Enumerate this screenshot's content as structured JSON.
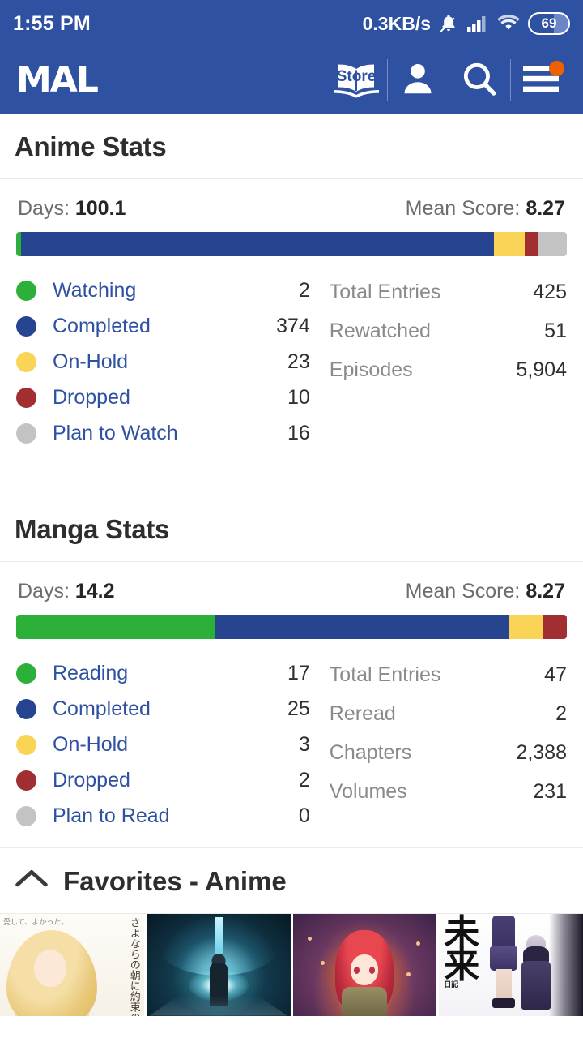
{
  "status_bar": {
    "time": "1:55 PM",
    "network_speed": "0.3KB/s",
    "battery_level": "69",
    "icons": [
      "bell-muted-icon",
      "signal-icon",
      "wifi-icon",
      "battery-icon"
    ]
  },
  "app_bar": {
    "logo": "MAL",
    "store_label": "Store",
    "icons": [
      "store-icon",
      "profile-icon",
      "search-icon",
      "menu-icon"
    ],
    "has_notification": true,
    "background": "#2e51a2",
    "notification_color": "#ef6100"
  },
  "anime_stats": {
    "title": "Anime Stats",
    "days_label": "Days:",
    "days_value": "100.1",
    "mean_score_label": "Mean Score:",
    "mean_score_value": "8.27",
    "legend": [
      {
        "label": "Watching",
        "value": "2",
        "color": "#2db039"
      },
      {
        "label": "Completed",
        "value": "374",
        "color": "#26448f"
      },
      {
        "label": "On-Hold",
        "value": "23",
        "color": "#f9d457"
      },
      {
        "label": "Dropped",
        "value": "10",
        "color": "#a12f31"
      },
      {
        "label": "Plan to Watch",
        "value": "16",
        "color": "#c3c3c3"
      }
    ],
    "side_stats": [
      {
        "label": "Total Entries",
        "value": "425"
      },
      {
        "label": "Rewatched",
        "value": "51"
      },
      {
        "label": "Episodes",
        "value": "5,904"
      }
    ]
  },
  "manga_stats": {
    "title": "Manga Stats",
    "days_label": "Days:",
    "days_value": "14.2",
    "mean_score_label": "Mean Score:",
    "mean_score_value": "8.27",
    "legend": [
      {
        "label": "Reading",
        "value": "17",
        "color": "#2db039"
      },
      {
        "label": "Completed",
        "value": "25",
        "color": "#26448f"
      },
      {
        "label": "On-Hold",
        "value": "3",
        "color": "#f9d457"
      },
      {
        "label": "Dropped",
        "value": "2",
        "color": "#a12f31"
      },
      {
        "label": "Plan to Read",
        "value": "0",
        "color": "#c3c3c3"
      }
    ],
    "side_stats": [
      {
        "label": "Total Entries",
        "value": "47"
      },
      {
        "label": "Reread",
        "value": "2"
      },
      {
        "label": "Chapters",
        "value": "2,388"
      },
      {
        "label": "Volumes",
        "value": "231"
      }
    ]
  },
  "favorites": {
    "title": "Favorites - Anime",
    "collapse_icon": "chevron-up-icon",
    "thumbnails": [
      {
        "overlay_text_top": "愛して、よかった。",
        "overlay_text": "さよならの朝に約束の花をかざろう"
      },
      {
        "overlay_text_top": "",
        "overlay_text": ""
      },
      {
        "overlay_text_top": "",
        "overlay_text": ""
      },
      {
        "overlay_text_top": "",
        "overlay_text": "未来",
        "overlay_sub": "日記"
      }
    ]
  },
  "chart_data": [
    {
      "type": "bar",
      "title": "Anime Stats",
      "orientation": "horizontal-stacked",
      "categories": [
        "Watching",
        "Completed",
        "On-Hold",
        "Dropped",
        "Plan to Watch"
      ],
      "values": [
        2,
        374,
        23,
        10,
        16
      ],
      "colors": [
        "#2db039",
        "#26448f",
        "#f9d457",
        "#a12f31",
        "#c3c3c3"
      ],
      "total": 425,
      "segment_percents": [
        0.9,
        85.8,
        5.6,
        2.6,
        5.1
      ],
      "legend_position": "below",
      "grid": false
    },
    {
      "type": "bar",
      "title": "Manga Stats",
      "orientation": "horizontal-stacked",
      "categories": [
        "Reading",
        "Completed",
        "On-Hold",
        "Dropped",
        "Plan to Read"
      ],
      "values": [
        17,
        25,
        3,
        2,
        0
      ],
      "colors": [
        "#2db039",
        "#26448f",
        "#f9d457",
        "#a12f31",
        "#c3c3c3"
      ],
      "total": 47,
      "segment_percents": [
        36.2,
        53.2,
        6.4,
        4.2,
        0
      ],
      "legend_position": "below",
      "grid": false
    }
  ]
}
